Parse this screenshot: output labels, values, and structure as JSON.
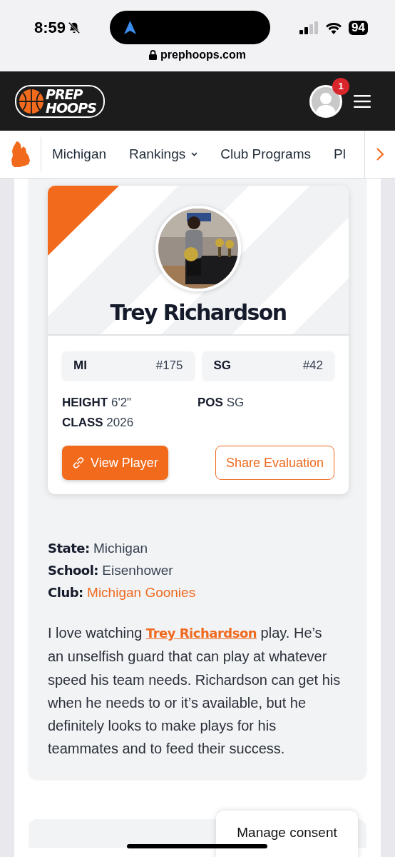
{
  "status_bar": {
    "time": "8:59",
    "battery": "94"
  },
  "browser": {
    "url": "prephoops.com"
  },
  "header": {
    "logo": [
      "PREP",
      "HOOPS"
    ],
    "notification_count": "1"
  },
  "nav": {
    "items": [
      {
        "label": "Michigan",
        "dropdown": false
      },
      {
        "label": "Rankings",
        "dropdown": true
      },
      {
        "label": "Club Programs",
        "dropdown": false
      },
      {
        "label": "Pl",
        "dropdown": false
      }
    ]
  },
  "player": {
    "name": "Trey Richardson",
    "ranks": [
      {
        "label": "MI",
        "value": "#175"
      },
      {
        "label": "SG",
        "value": "#42"
      }
    ],
    "attributes": [
      {
        "label": "HEIGHT",
        "value": "6'2\""
      },
      {
        "label": "POS",
        "value": "SG"
      },
      {
        "label": "CLASS",
        "value": "2026"
      }
    ],
    "buttons": [
      {
        "label": "View Player",
        "kind": "primary"
      },
      {
        "label": "Share Evaluation",
        "kind": "outline"
      }
    ]
  },
  "details": [
    {
      "label": "State:",
      "value": "Michigan",
      "kind": "text"
    },
    {
      "label": "School:",
      "value": "Eisenhower",
      "kind": "text"
    },
    {
      "label": "Club:",
      "value": "Michigan Goonies",
      "kind": "link"
    }
  ],
  "evaluation": {
    "before": "I love watching",
    "link": "Trey Richardson",
    "after": "play. He’s an unselfish guard that can play at whatever speed his team needs. Richardson can get his when he needs to or it’s available, but he definitely looks to make plays for his teammates and to feed their success."
  },
  "consent": {
    "label": "Manage consent"
  }
}
